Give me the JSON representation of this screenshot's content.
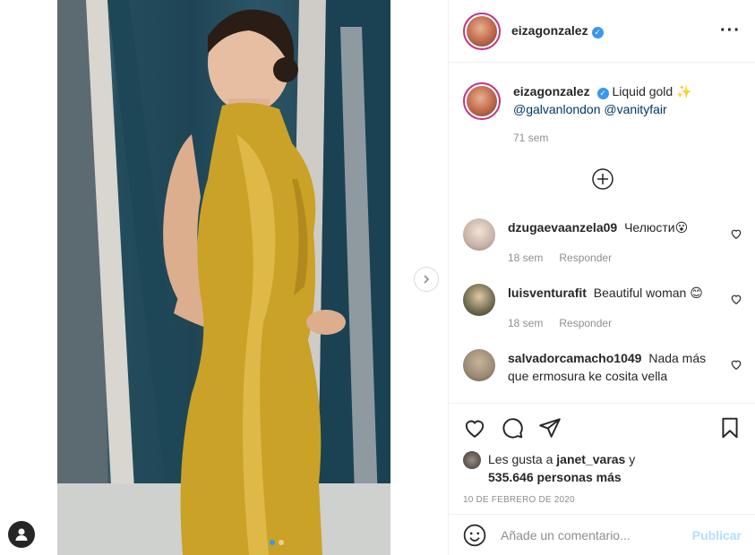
{
  "post": {
    "username": "eizagonzalez",
    "verified_icon": "verified-badge-icon",
    "caption": "Liquid gold",
    "caption_emoji": "✨",
    "mentions": [
      "@galvanlondon",
      "@vanityfair"
    ],
    "caption_age": "71 sem"
  },
  "comments": [
    {
      "username": "dzugaevaanzela09",
      "text": "Челюсти😮",
      "age": "18 sem",
      "reply": "Responder"
    },
    {
      "username": "luisventurafit",
      "text": "Beautiful woman 😊",
      "age": "18 sem",
      "reply": "Responder"
    },
    {
      "username": "salvadorcamacho1049",
      "text": "Nada más que ermosura ke cosita vella"
    }
  ],
  "likes": {
    "prefix": "Les gusta a",
    "user": "janet_varas",
    "joiner": "y",
    "count_text": "535.646 personas más"
  },
  "date": "10 DE FEBRERO DE 2020",
  "comment_box": {
    "placeholder": "Añade un comentario...",
    "publish_label": "Publicar"
  },
  "colors": {
    "accent": "#3897f0",
    "publish_disabled": "#b2dffc",
    "dress": "#c9a227"
  },
  "carousel": {
    "current": 1,
    "total": 2
  }
}
